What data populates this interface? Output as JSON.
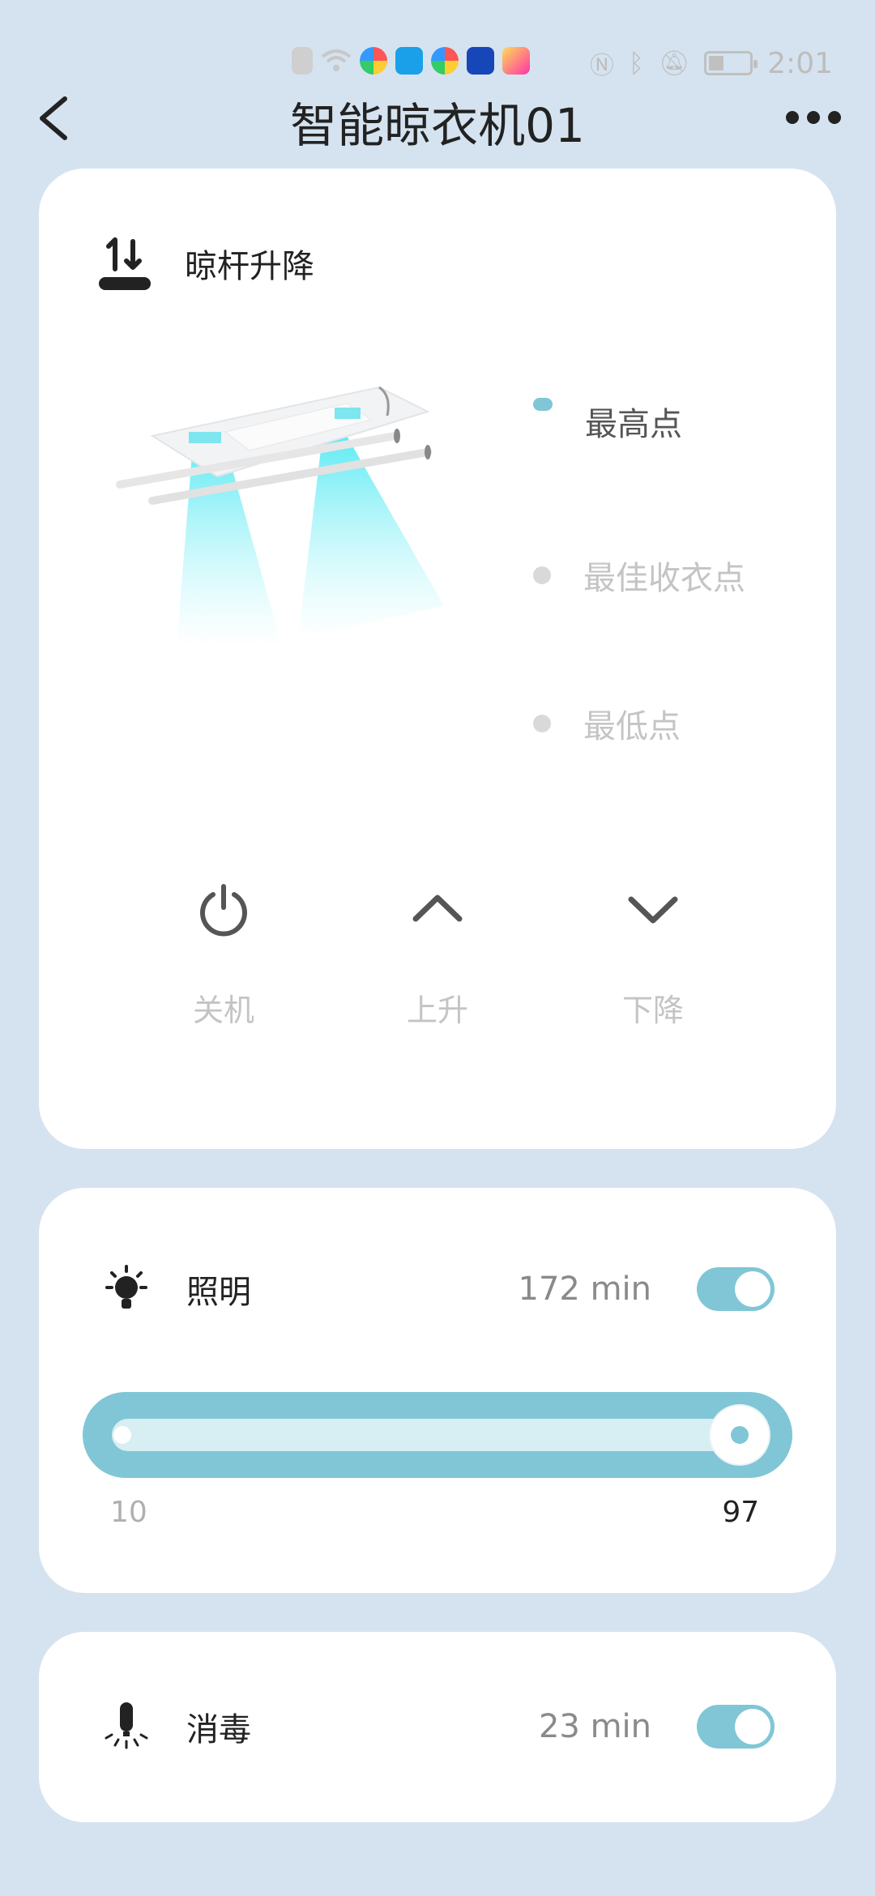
{
  "status_bar": {
    "time": "2:01",
    "battery_level": 0.35
  },
  "header": {
    "title": "智能晾衣机01"
  },
  "lift": {
    "title": "晾杆升降",
    "positions": [
      {
        "label": "最高点",
        "active": true
      },
      {
        "label": "最佳收衣点",
        "active": false
      },
      {
        "label": "最低点",
        "active": false
      }
    ],
    "controls": {
      "power": "关机",
      "up": "上升",
      "down": "下降"
    }
  },
  "lighting": {
    "title": "照明",
    "time": "172 min",
    "enabled": true,
    "slider": {
      "min": 10,
      "value": 97,
      "max": 100
    }
  },
  "disinfect": {
    "title": "消毒",
    "time": "23 min",
    "enabled": true
  },
  "colors": {
    "accent": "#80c6d6",
    "background": "#d5e3f0",
    "muted": "#c4c4c4"
  }
}
